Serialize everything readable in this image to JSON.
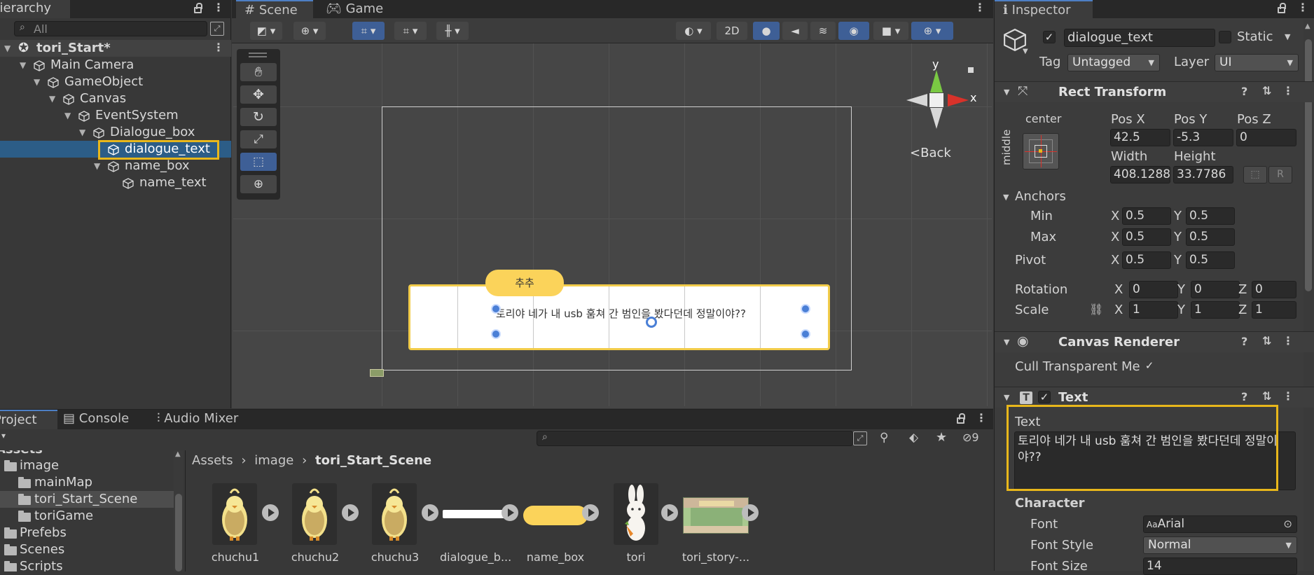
{
  "hierarchy": {
    "tab": "Hierarchy",
    "search_placeholder": "All",
    "scene_name": "tori_Start*",
    "items": [
      {
        "label": "Main Camera"
      },
      {
        "label": "GameObject"
      },
      {
        "label": "Canvas"
      },
      {
        "label": "EventSystem"
      },
      {
        "label": "Dialogue_box"
      },
      {
        "label": "dialogue_text"
      },
      {
        "label": "name_box"
      },
      {
        "label": "name_text"
      }
    ]
  },
  "scene_view": {
    "tabs": [
      "Scene",
      "Game"
    ],
    "btn_2d": "2D",
    "gizmo_y": "y",
    "gizmo_x": "x",
    "back_label": "Back",
    "name_plate": "추추",
    "dialogue_line": "토리야 네가 내 usb 훔쳐 간 범인을 봤다던데 정말이야??"
  },
  "inspector": {
    "tab": "Inspector",
    "object_name": "dialogue_text",
    "static_label": "Static",
    "tag_label": "Tag",
    "tag_value": "Untagged",
    "layer_label": "Layer",
    "layer_value": "UI",
    "rect_transform": {
      "title": "Rect Transform",
      "anchor_h": "center",
      "anchor_v": "middle",
      "pos_x_label": "Pos X",
      "pos_x": "42.5",
      "pos_y_label": "Pos Y",
      "pos_y": "-5.3",
      "pos_z_label": "Pos Z",
      "pos_z": "0",
      "width_label": "Width",
      "width": "408.1288",
      "height_label": "Height",
      "height": "33.7786",
      "r_label": "R",
      "anchors_label": "Anchors",
      "min_label": "Min",
      "min_x": "0.5",
      "min_y": "0.5",
      "max_label": "Max",
      "max_x": "0.5",
      "max_y": "0.5",
      "pivot_label": "Pivot",
      "pivot_x": "0.5",
      "pivot_y": "0.5",
      "rotation_label": "Rotation",
      "rot_x": "0",
      "rot_y": "0",
      "rot_z": "0",
      "scale_label": "Scale",
      "scale_x": "1",
      "scale_y": "1",
      "scale_z": "1",
      "x": "X",
      "y": "Y",
      "z": "Z"
    },
    "canvas_renderer": {
      "title": "Canvas Renderer",
      "cull_label": "Cull Transparent Me"
    },
    "text_comp": {
      "title": "Text",
      "text_label": "Text",
      "text_value": "토리야 네가 내 usb 훔쳐 간 범인을 봤다던데 정말이야??",
      "character_label": "Character",
      "font_label": "Font",
      "font_value": "Arial",
      "font_prefix": "Aa",
      "font_style_label": "Font Style",
      "font_style_value": "Normal",
      "font_size_label": "Font Size",
      "font_size_value": "14"
    }
  },
  "bottom": {
    "tabs": [
      "Project",
      "Console",
      "Audio Mixer"
    ],
    "hidden_count": "9",
    "assets_root": "Assets",
    "folders": [
      {
        "label": "image"
      },
      {
        "label": "mainMap"
      },
      {
        "label": "tori_Start_Scene"
      },
      {
        "label": "toriGame"
      },
      {
        "label": "Prefebs"
      },
      {
        "label": "Scenes"
      },
      {
        "label": "Scripts"
      }
    ],
    "breadcrumb": [
      "Assets",
      "image",
      "tori_Start_Scene"
    ],
    "assets": [
      {
        "label": "chuchu1"
      },
      {
        "label": "chuchu2"
      },
      {
        "label": "chuchu3"
      },
      {
        "label": "dialogue_b..."
      },
      {
        "label": "name_box"
      },
      {
        "label": "tori"
      },
      {
        "label": "tori_story-..."
      }
    ]
  },
  "colors": {
    "selection": "#2c5d87",
    "highlight_box": "#e8b71b",
    "accent_blue": "#3e5f96",
    "dialogue_border": "#f2cc4a"
  }
}
